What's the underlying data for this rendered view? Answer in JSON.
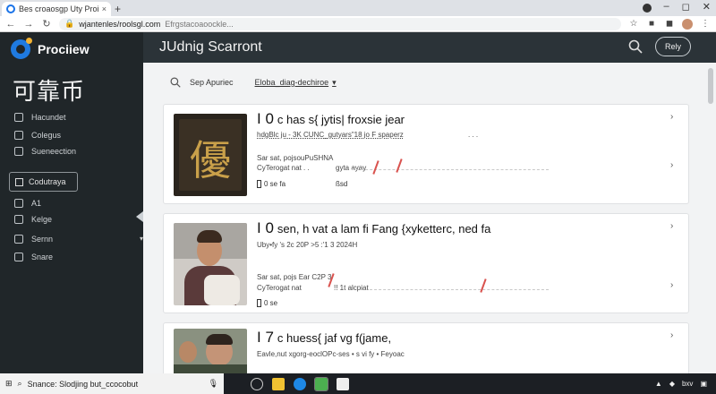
{
  "browser": {
    "tab_title": "Bes croaosgp Uty Proiviewr",
    "new_tab": "+",
    "url_host": "wjantenles/roolsgl.com",
    "url_path": "Efrgstacoaoockle...",
    "ctl_min": "‒",
    "ctl_max": "◻",
    "ctl_close": "✕"
  },
  "sidebar": {
    "brand": "Prociiew",
    "cjk_title": "可靠币",
    "items_top": [
      {
        "label": "Hacundet",
        "icon": "grid-icon"
      },
      {
        "label": "Colegus",
        "icon": "monitor-icon"
      },
      {
        "label": "Sueneection",
        "icon": "text-icon"
      }
    ],
    "button_label": "Codutraya",
    "items_bottom": [
      {
        "label": "A1",
        "icon": "search-icon"
      },
      {
        "label": "Kelge",
        "icon": "shield-icon"
      },
      {
        "label": "Sernn",
        "icon": "monitor-icon"
      },
      {
        "label": "Snare",
        "icon": "grid-icon"
      }
    ]
  },
  "header": {
    "title": "JUdnig Scarront",
    "reply_label": "Rely"
  },
  "toolbar": {
    "search_label": "Sep Apuriec",
    "filter_label": "Eloba_diag-dechiroe"
  },
  "cards": [
    {
      "title_cap": "I 0",
      "title": "c has s{ jytis| froxsie jear",
      "subtitle": "hdgBlc ju - 3K CUNC_gutyars\"18 jo F spaperz",
      "sub_dots": ". . .",
      "line3": "Sar sat, pojsouPuSHNA",
      "line4": "CyTerogat nat . .",
      "line4b": "gyta ayay",
      "stat1": "0 se fa",
      "stat2": "ßsd",
      "image_caption": "優"
    },
    {
      "title_cap": "I 0",
      "title": "sen, h vat a lam fi Fang {xyketterc, ned fa",
      "subtitle": "Uby•fy 's 2c 20P >5 :'1 3 2024H",
      "sub_dots": "",
      "line3": "Sar sat, pojs Ear C2P 3",
      "line4": "CyTerogat nat",
      "line4b": "!! 1t alcpiat",
      "stat1": "0 se",
      "stat2": "",
      "image_caption": ""
    },
    {
      "title_cap": "I 7",
      "title": "c huess{ jaf vg f(jame,",
      "subtitle": "Eavle,nut xgorg-eoclOPc-ses • s vi fy • Feyoac",
      "sub_dots": "",
      "line3": "",
      "line4": "",
      "line4b": "",
      "stat1": "",
      "stat2": "",
      "image_caption": ""
    }
  ],
  "taskbar": {
    "search_text": "Snance: Slodjing but_ccocobut",
    "time": "bxv"
  },
  "colors": {
    "sidebar_bg": "#202629",
    "header_bg": "#2b3338",
    "accent": "#1f7ae0",
    "red_tick": "#d9534f"
  }
}
